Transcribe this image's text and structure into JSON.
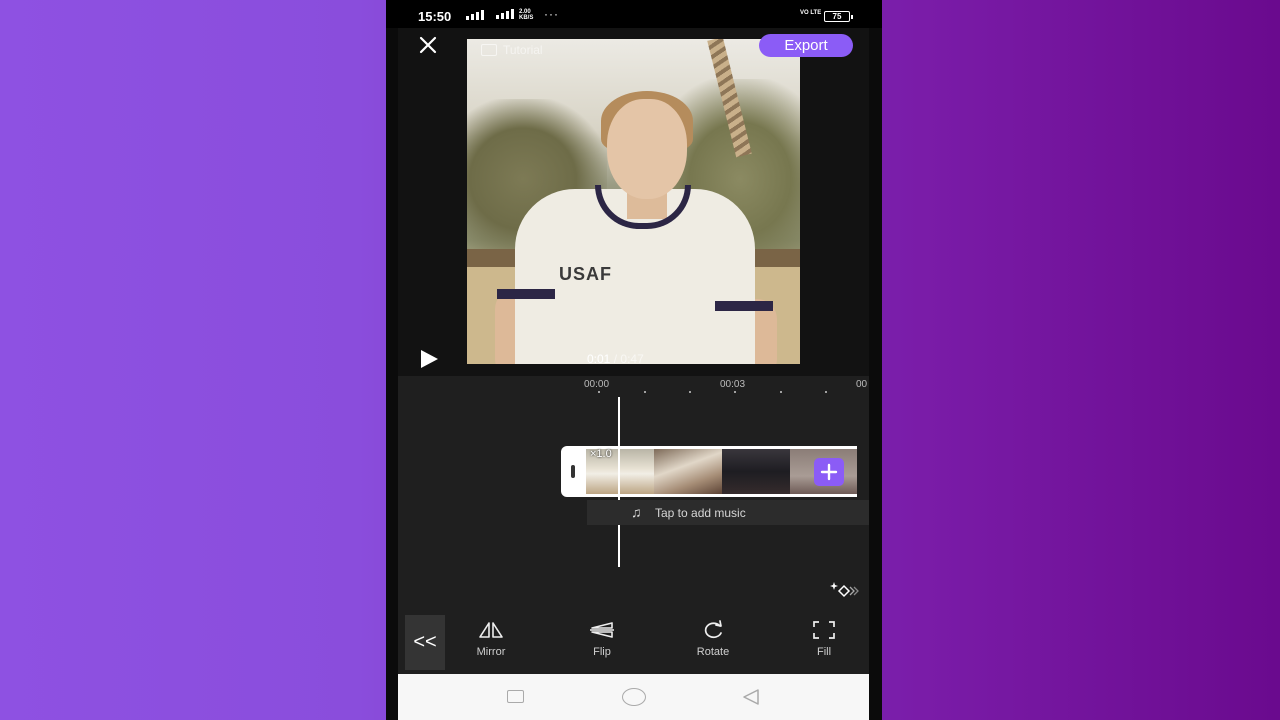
{
  "status_bar": {
    "time": "15:50",
    "speed_value": "2.00",
    "speed_unit": "KB/S",
    "more": "···",
    "network_label": "VO LTE",
    "battery": "75"
  },
  "header": {
    "close_icon": "close-icon",
    "tutorial_label": "Tutorial",
    "export_label": "Export",
    "accent_color": "#8b5cf6"
  },
  "preview": {
    "current_time": "0:01",
    "separator": "/",
    "total_time": "0:47",
    "shirt_text": "USAF",
    "play_icon": "play-icon"
  },
  "timeline": {
    "ticks": [
      "00:00",
      "00:03",
      "00"
    ],
    "speed_badge": "×1.0",
    "add_music_label": "Tap to add music",
    "add_clip_icon": "plus-icon"
  },
  "toolbar": {
    "back_label": "<<",
    "tools": [
      {
        "label": "Mirror",
        "icon": "mirror-icon"
      },
      {
        "label": "Flip",
        "icon": "flip-icon"
      },
      {
        "label": "Rotate",
        "icon": "rotate-icon"
      },
      {
        "label": "Fill",
        "icon": "fill-icon"
      }
    ]
  }
}
